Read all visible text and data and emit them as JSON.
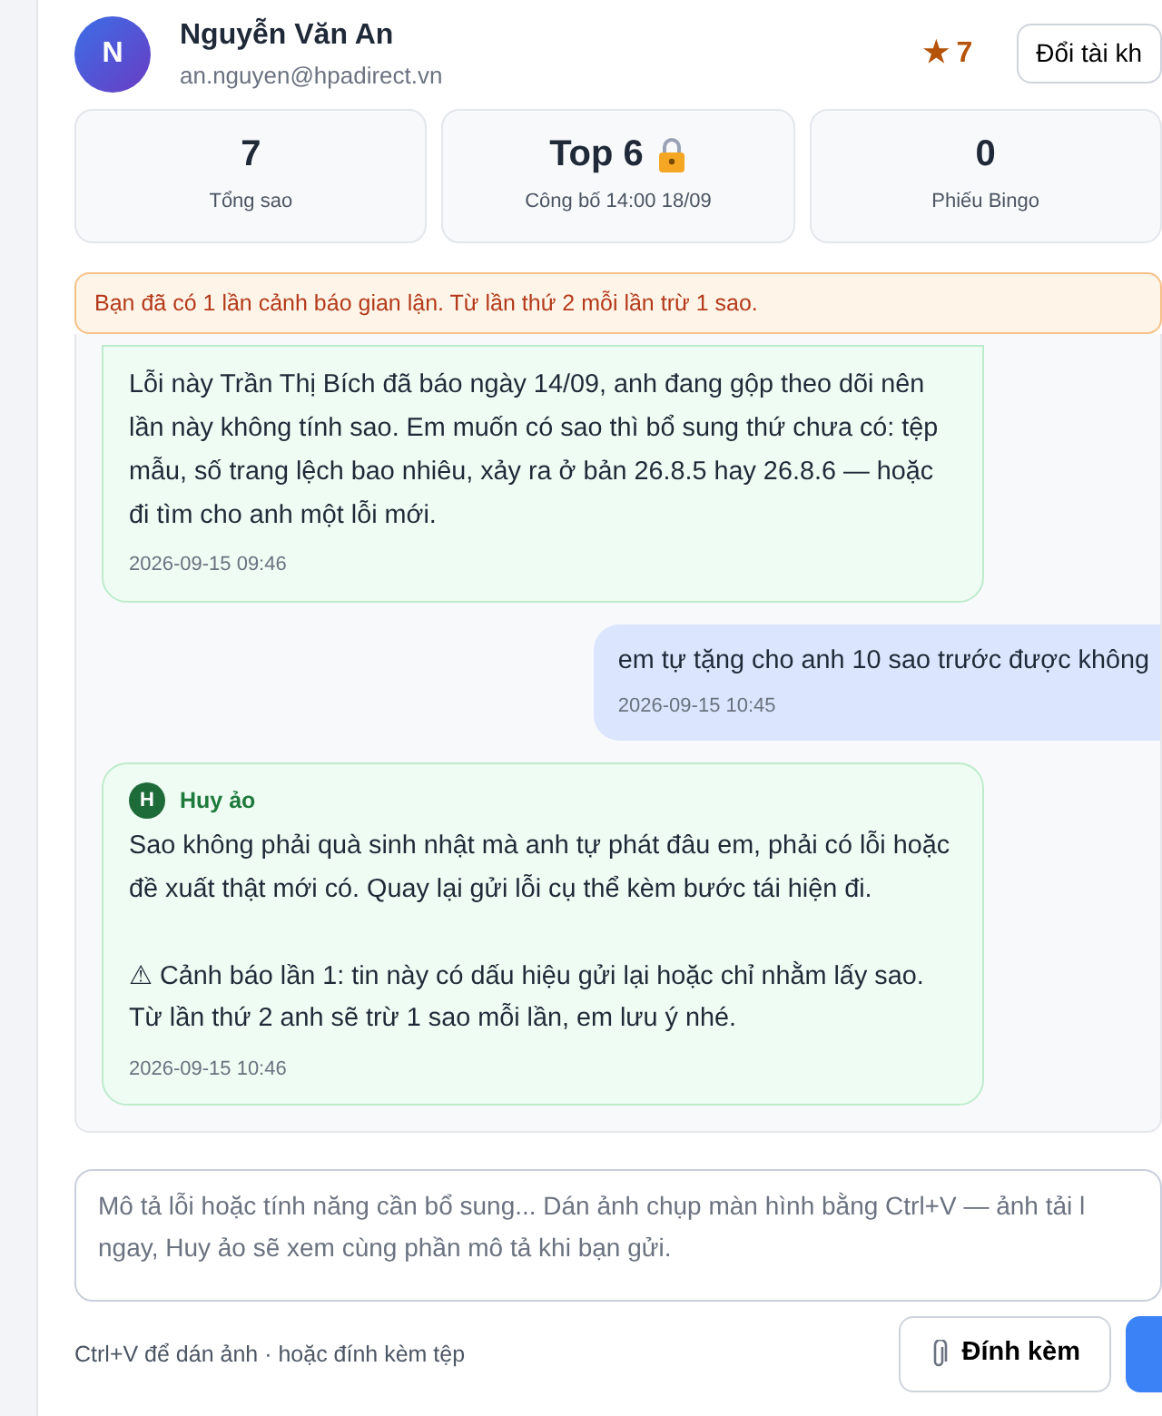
{
  "profile": {
    "avatar_letter": "N",
    "name": "Nguyễn Văn An",
    "email": "an.nguyen@hpadirect.vn",
    "star_icon": "★",
    "star_count": "7",
    "switch_button": "Đổi tài kh"
  },
  "stats": [
    {
      "value": "7",
      "locked": false,
      "label": "Tổng sao"
    },
    {
      "value": "Top 6",
      "locked": true,
      "label": "Công bố 14:00 18/09"
    },
    {
      "value": "0",
      "locked": false,
      "label": "Phiếu Bingo"
    }
  ],
  "alert": "Bạn đã có 1 lần cảnh báo gian lận. Từ lần thứ 2 mỗi lần trừ 1 sao.",
  "messages": [
    {
      "kind": "bot",
      "text": "Lỗi này Trần Thị Bích đã báo ngày 14/09, anh đang gộp theo dõi nên lần này không tính sao. Em muốn có sao thì bổ sung thứ chưa có: tệp mẫu, số trang lệch bao nhiêu, xảy ra ở bản 26.8.5 hay 26.8.6 — hoặc đi tìm cho anh một lỗi mới.",
      "time": "2026-09-15 09:46"
    },
    {
      "kind": "user",
      "text": "em tự tặng cho anh 10 sao trước được không",
      "time": "2026-09-15 10:45"
    },
    {
      "kind": "bot",
      "avatar_letter": "H",
      "sender": "Huy ảo",
      "text": "Sao không phải quà sinh nhật mà anh tự phát đâu em, phải có lỗi hoặc đề xuất thật mới có. Quay lại gửi lỗi cụ thể kèm bước tái hiện đi.\n\n⚠ Cảnh báo lần 1: tin này có dấu hiệu gửi lại hoặc chỉ nhằm lấy sao. Từ lần thứ 2 anh sẽ trừ 1 sao mỗi lần, em lưu ý nhé.",
      "time": "2026-09-15 10:46"
    }
  ],
  "composer": {
    "placeholder": "Mô tả lỗi hoặc tính năng cần bổ sung... Dán ảnh chụp màn hình bằng Ctrl+V — ảnh tải l\nngay, Huy ảo sẽ xem cùng phần mô tả khi bạn gửi.",
    "hint": "Ctrl+V để dán ảnh · hoặc đính kèm tệp",
    "attach_button": "Đính kèm"
  }
}
